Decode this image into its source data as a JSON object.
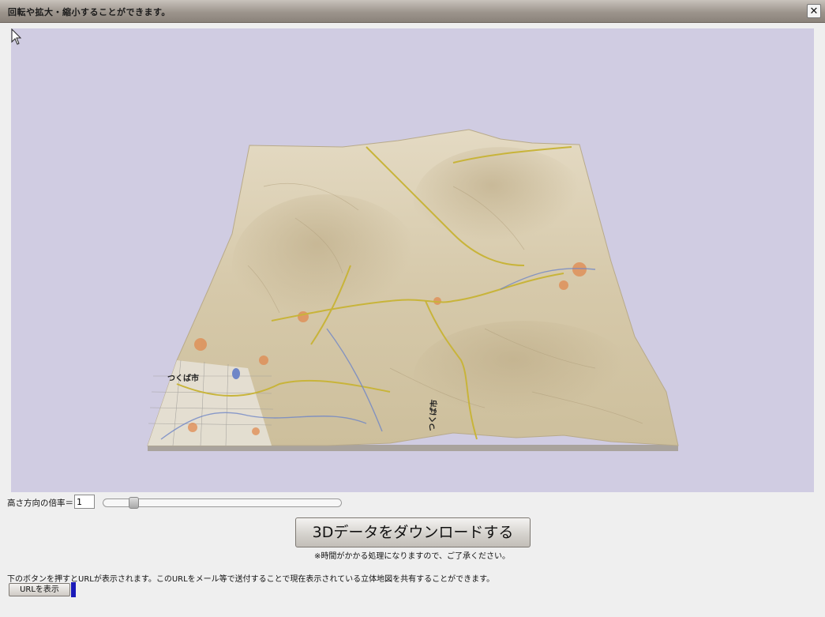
{
  "window": {
    "title": "回転や拡大・縮小することができます。",
    "close_icon": "close-icon"
  },
  "map": {
    "labels": [
      "つくば市",
      "つくば市"
    ],
    "colors": {
      "background": "#d0cce2",
      "terrain": "#d8cdb2",
      "roads": "#c8b43a",
      "towns": "#e0894f",
      "water": "#6f86c7"
    }
  },
  "controls": {
    "height_label": "高さ方向の倍率＝",
    "height_value": "1",
    "slider_level": 0.11
  },
  "download": {
    "label": "3Dデータをダウンロードする",
    "note": "※時間がかかる処理になりますので、ご了承ください。"
  },
  "share": {
    "text": "下のボタンを押すとURLが表示されます。このURLをメール等で送付することで現在表示されている立体地図を共有することができます。",
    "button_label": "URLを表示"
  }
}
